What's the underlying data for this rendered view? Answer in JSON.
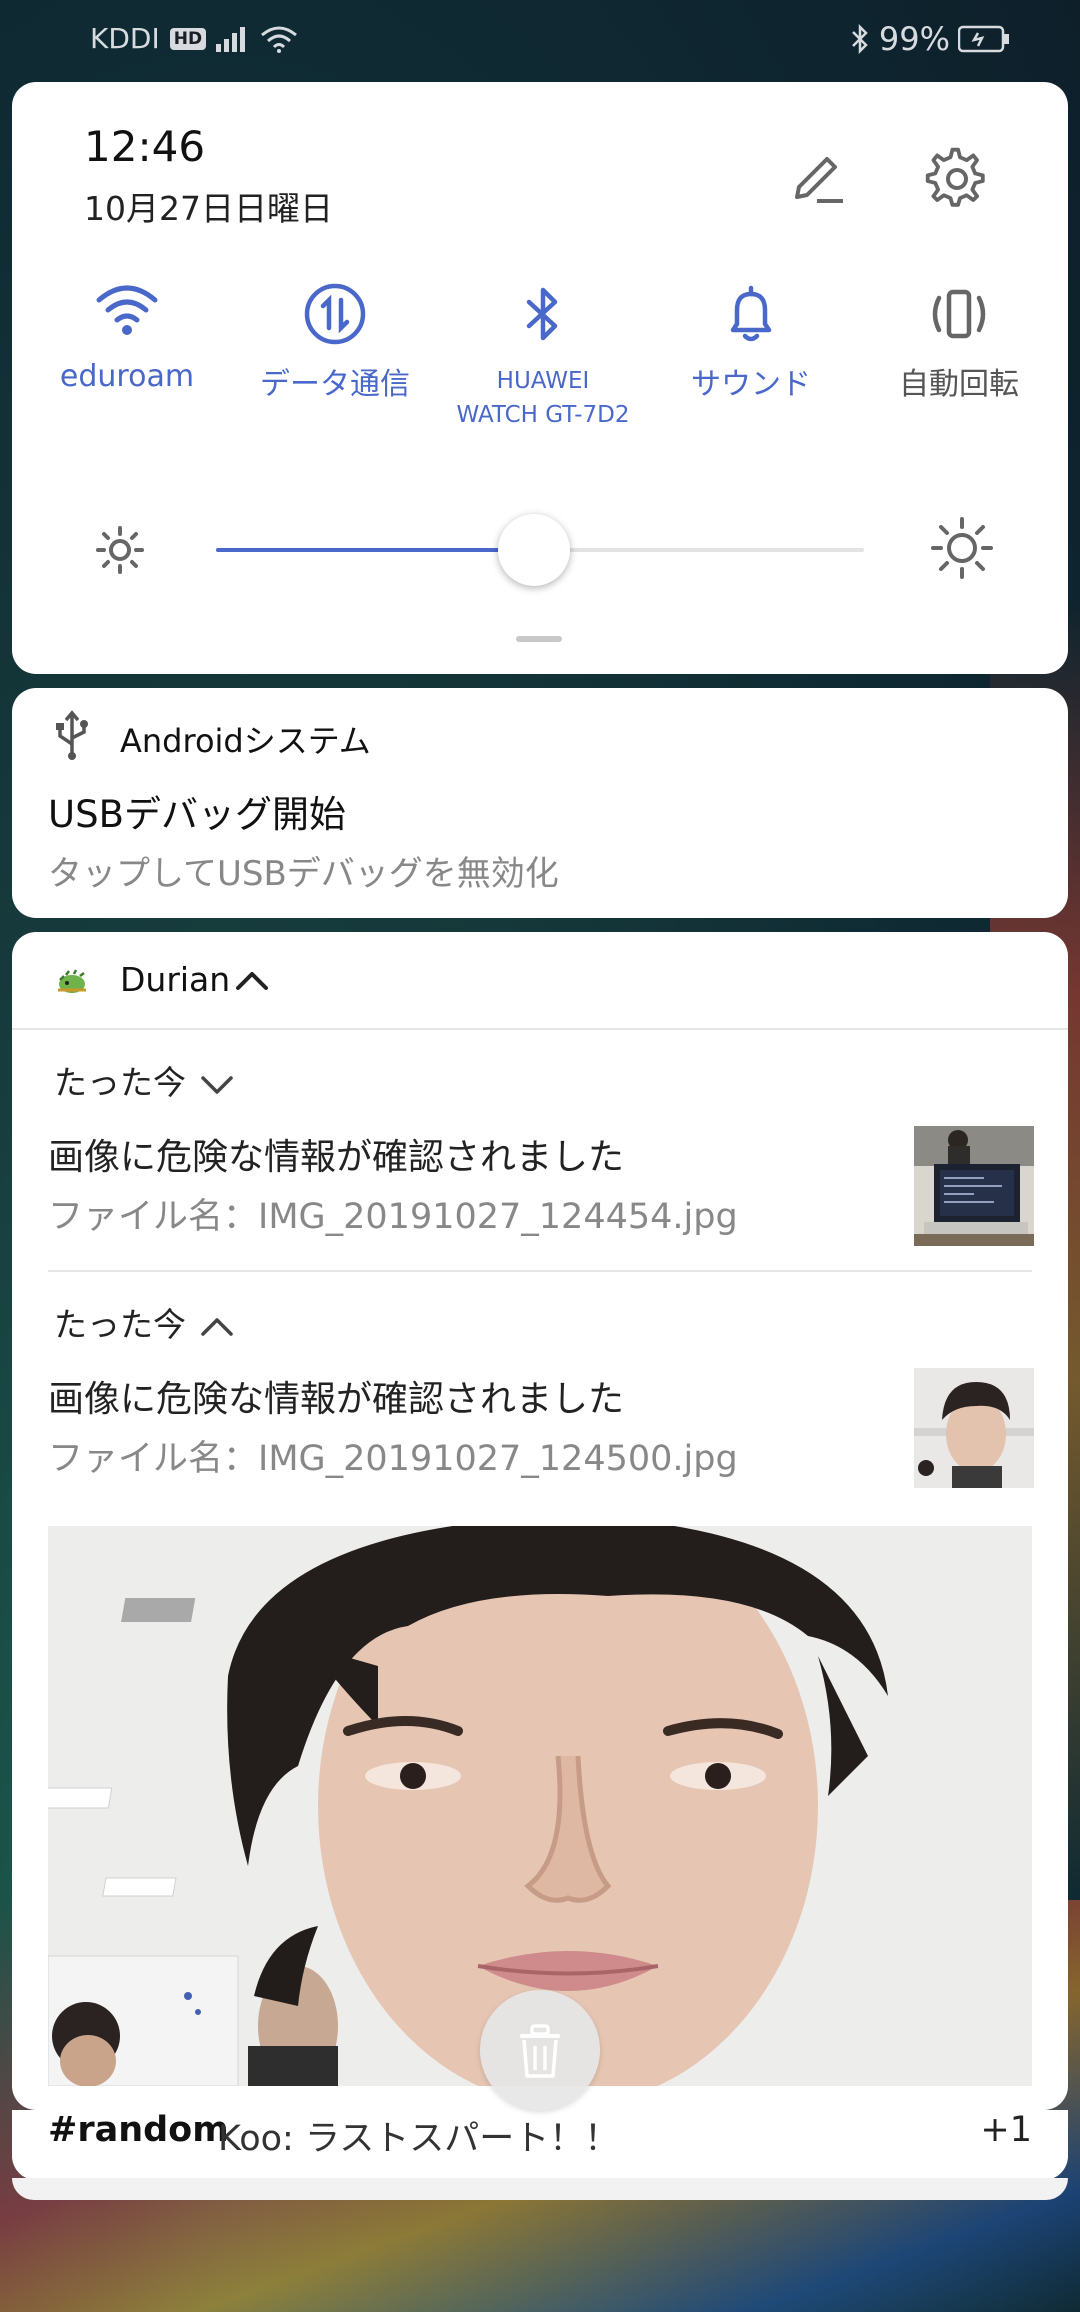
{
  "status_bar": {
    "carrier": "KDDI",
    "hd_badge": "HD",
    "battery": "99%"
  },
  "quick_settings": {
    "time": "12:46",
    "date": "10月27日日曜日",
    "tiles": [
      {
        "label": "eduroam",
        "icon": "wifi-icon",
        "active": true
      },
      {
        "label": "データ通信",
        "icon": "mobile-data-icon",
        "active": true
      },
      {
        "label": "HUAWEI WATCH GT-7D2",
        "icon": "bluetooth-icon",
        "active": true
      },
      {
        "label": "サウンド",
        "icon": "bell-icon",
        "active": true
      },
      {
        "label": "自動回転",
        "icon": "auto-rotate-icon",
        "active": false
      }
    ],
    "brightness": 0.49,
    "accent": "#4a68c9"
  },
  "usb_notification": {
    "app": "Androidシステム",
    "title": "USBデバッグ開始",
    "body": "タップしてUSBデバッグを無効化"
  },
  "durian_notification": {
    "app": "Durian",
    "items": [
      {
        "time": "たった今",
        "title": "画像に危険な情報が確認されました",
        "body": "ファイル名：IMG_20191027_124454.jpg",
        "expanded": false
      },
      {
        "time": "たった今",
        "title": "画像に危険な情報が確認されました",
        "body": "ファイル名：IMG_20191027_124500.jpg",
        "expanded": true
      }
    ]
  },
  "collapsed_notification": {
    "channel": "#random",
    "message": "Koo: ラストスパート！！",
    "more": "+1"
  }
}
